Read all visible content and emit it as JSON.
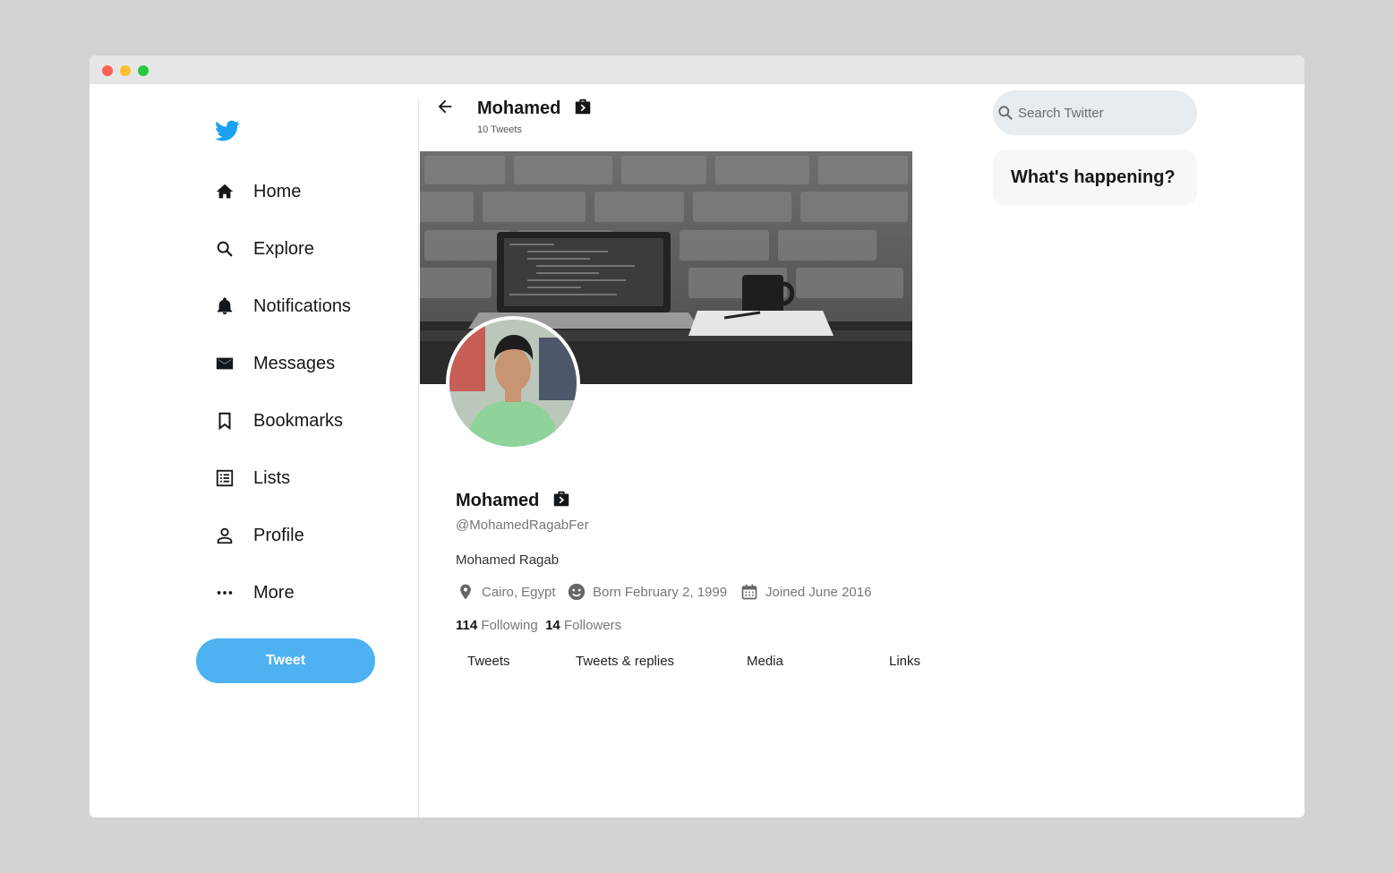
{
  "nav": {
    "items": [
      {
        "label": "Home",
        "icon": "home-icon"
      },
      {
        "label": "Explore",
        "icon": "search-icon"
      },
      {
        "label": "Notifications",
        "icon": "bell-icon"
      },
      {
        "label": "Messages",
        "icon": "envelope-icon"
      },
      {
        "label": "Bookmarks",
        "icon": "bookmark-icon"
      },
      {
        "label": "Lists",
        "icon": "list-icon"
      },
      {
        "label": "Profile",
        "icon": "person-icon"
      },
      {
        "label": "More",
        "icon": "more-dots-icon"
      }
    ],
    "tweet_button": "Tweet"
  },
  "header": {
    "name": "Mohamed",
    "tweet_count": "10 Tweets"
  },
  "profile": {
    "name": "Mohamed",
    "handle": "@MohamedRagabFer",
    "bio": "Mohamed Ragab",
    "location": "Cairo, Egypt",
    "born": "Born February 2, 1999",
    "joined": "Joined June 2016",
    "following_count": "114",
    "following_label": "Following",
    "followers_count": "14",
    "followers_label": "Followers"
  },
  "tabs": [
    "Tweets",
    "Tweets & replies",
    "Media",
    "Links"
  ],
  "search": {
    "placeholder": "Search Twitter"
  },
  "trends": {
    "title": "What's happening?"
  },
  "colors": {
    "accent": "#4db1f2",
    "background": "#d3d3d3",
    "twitter_blue": "#1da1f2"
  }
}
